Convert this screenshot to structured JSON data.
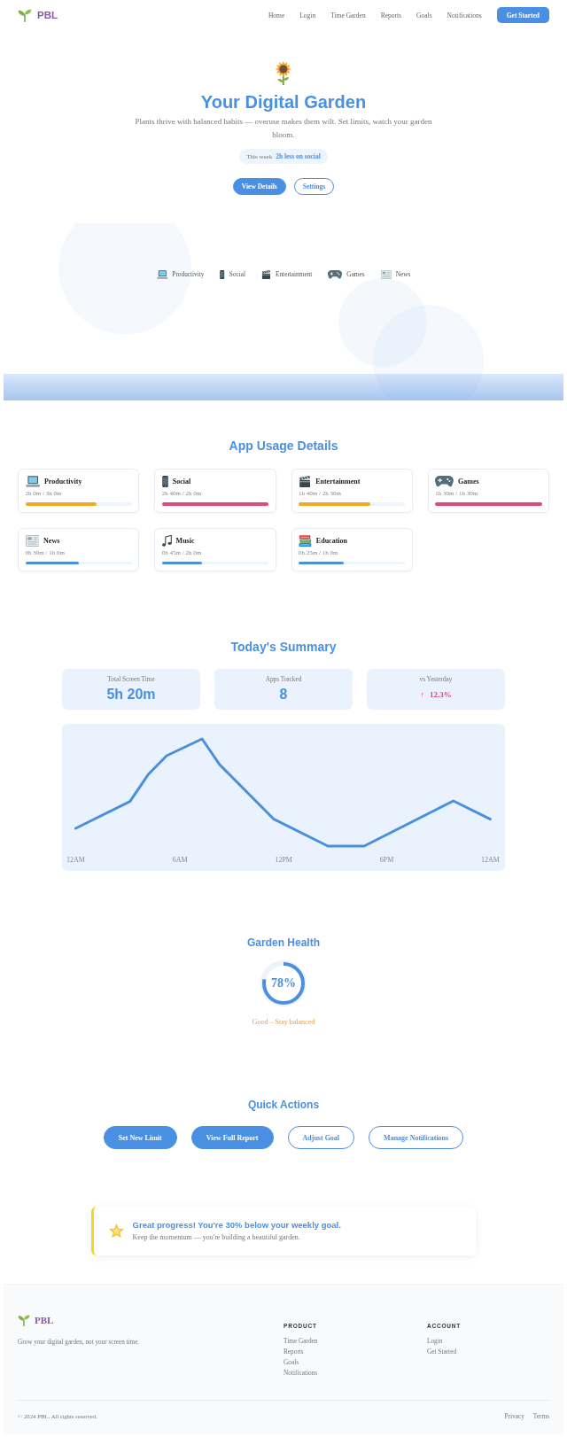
{
  "header": {
    "logo": "PBL",
    "nav": [
      "Home",
      "Login",
      "Time Garden",
      "Reports",
      "Goals",
      "Notifications"
    ],
    "cta": "Get Started"
  },
  "hero": {
    "title": "Your Digital Garden",
    "subtitle": "Plants thrive with balanced habits — overuse makes them wilt. Set limits, watch your garden bloom.",
    "badge": {
      "label": "This week",
      "value": "2h less on social"
    },
    "buttons": [
      {
        "label": "View Details",
        "kind": "primary"
      },
      {
        "label": "Settings",
        "kind": "outline"
      }
    ],
    "legend": [
      "Productivity",
      "Social",
      "Entertainment",
      "Games",
      "News"
    ]
  },
  "usage": {
    "title": "App Usage Details",
    "items": [
      {
        "name": "Productivity",
        "time": "2h 0m / 3h 0m",
        "level": 0.67,
        "color": "#f5a623"
      },
      {
        "name": "Social",
        "time": "2h 40m / 2h 0m",
        "level": 1,
        "color": "#e2487a"
      },
      {
        "name": "Entertainment",
        "time": "1h 40m / 2h 30m",
        "level": 0.67,
        "color": "#f5a623"
      },
      {
        "name": "Games",
        "time": "1h 30m / 1h 30m",
        "level": 1,
        "color": "#e2487a"
      },
      {
        "name": "News",
        "time": "0h 30m / 1h 0m",
        "level": 0.5,
        "color": "#4a90e2"
      },
      {
        "name": "Music",
        "time": "0h 45m / 2h 0m",
        "level": 0.38,
        "color": "#4a90e2"
      },
      {
        "name": "Education",
        "time": "0h 25m / 1h 0m",
        "level": 0.42,
        "color": "#4a90e2"
      }
    ]
  },
  "summary": {
    "title": "Today's Summary",
    "stats": [
      {
        "label": "Total Screen Time",
        "kind": "count",
        "value": "5h 20m"
      },
      {
        "label": "Apps Tracked",
        "kind": "count",
        "value": "8"
      },
      {
        "label": "vs Yesterday",
        "kind": "change",
        "arrow": "↑",
        "value": "12.3%"
      }
    ],
    "chart": {
      "x_labels": [
        "12AM",
        "6AM",
        "12PM",
        "6PM",
        "12AM"
      ]
    }
  },
  "health": {
    "title": "Garden Health",
    "value": "78%",
    "level": 0.78,
    "status": "Good – Stay balanced"
  },
  "actions": {
    "title": "Quick Actions",
    "buttons": [
      {
        "label": "Set New Limit",
        "kind": "primary"
      },
      {
        "label": "View Full Report",
        "kind": "primary"
      },
      {
        "label": "Adjust Goal",
        "kind": "outline"
      },
      {
        "label": "Manage Notifications",
        "kind": "outline"
      }
    ]
  },
  "banner": {
    "title": "Great progress! You're 30% below your weekly goal.",
    "text": "Keep the momentum — you're building a beautiful garden."
  },
  "footer": {
    "logo": "PBL",
    "tagline": "Grow your digital garden, not your screen time.",
    "columns": [
      {
        "title": "PRODUCT",
        "links": [
          "Time Garden",
          "Reports",
          "Goals",
          "Notifications"
        ]
      },
      {
        "title": "ACCOUNT",
        "links": [
          "Login",
          "Get Started"
        ]
      }
    ],
    "copyright": "© 2024 PBL. All rights reserved.",
    "links": [
      "Privacy",
      "Terms"
    ]
  }
}
